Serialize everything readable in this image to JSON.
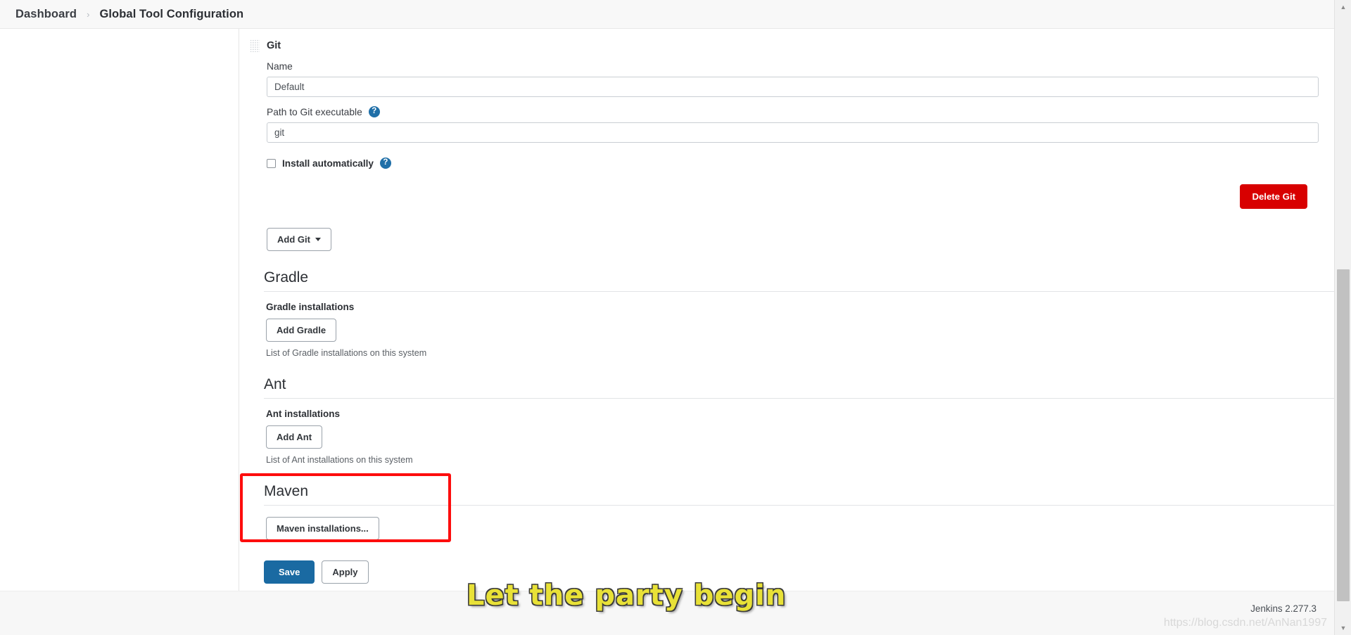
{
  "breadcrumb": {
    "items": [
      "Dashboard",
      "Global Tool Configuration"
    ],
    "separator": "›"
  },
  "git": {
    "title": "Git",
    "drag_handle_icon": "drag-handle-icon",
    "name_label": "Name",
    "name_value": "Default",
    "path_label": "Path to Git executable",
    "path_help_icon": "?",
    "path_value": "git",
    "install_auto_label": "Install automatically",
    "install_auto_help_icon": "?",
    "install_auto_checked": false,
    "delete_label": "Delete Git",
    "add_label": "Add Git",
    "add_caret_icon": "chevron-down-icon"
  },
  "gradle": {
    "heading": "Gradle",
    "sub_label": "Gradle installations",
    "add_label": "Add Gradle",
    "note": "List of Gradle installations on this system"
  },
  "ant": {
    "heading": "Ant",
    "sub_label": "Ant installations",
    "add_label": "Add Ant",
    "note": "List of Ant installations on this system"
  },
  "maven": {
    "heading": "Maven",
    "installations_label": "Maven installations...",
    "highlight_color": "#fd0d0d"
  },
  "actions": {
    "save_label": "Save",
    "apply_label": "Apply"
  },
  "footer": {
    "version": "Jenkins 2.277.3",
    "watermark": "https://blog.csdn.net/AnNan1997"
  },
  "overlay": {
    "party_text": "Let the party begin",
    "party_color": "#e8e137"
  },
  "scrollbar": {
    "up_arrow_icon": "▲",
    "down_arrow_icon": "▼"
  },
  "colors": {
    "primary": "#1a6aa2",
    "danger": "#d80000",
    "help": "#1f6fa8",
    "bar_bg": "#f8f8f8"
  }
}
